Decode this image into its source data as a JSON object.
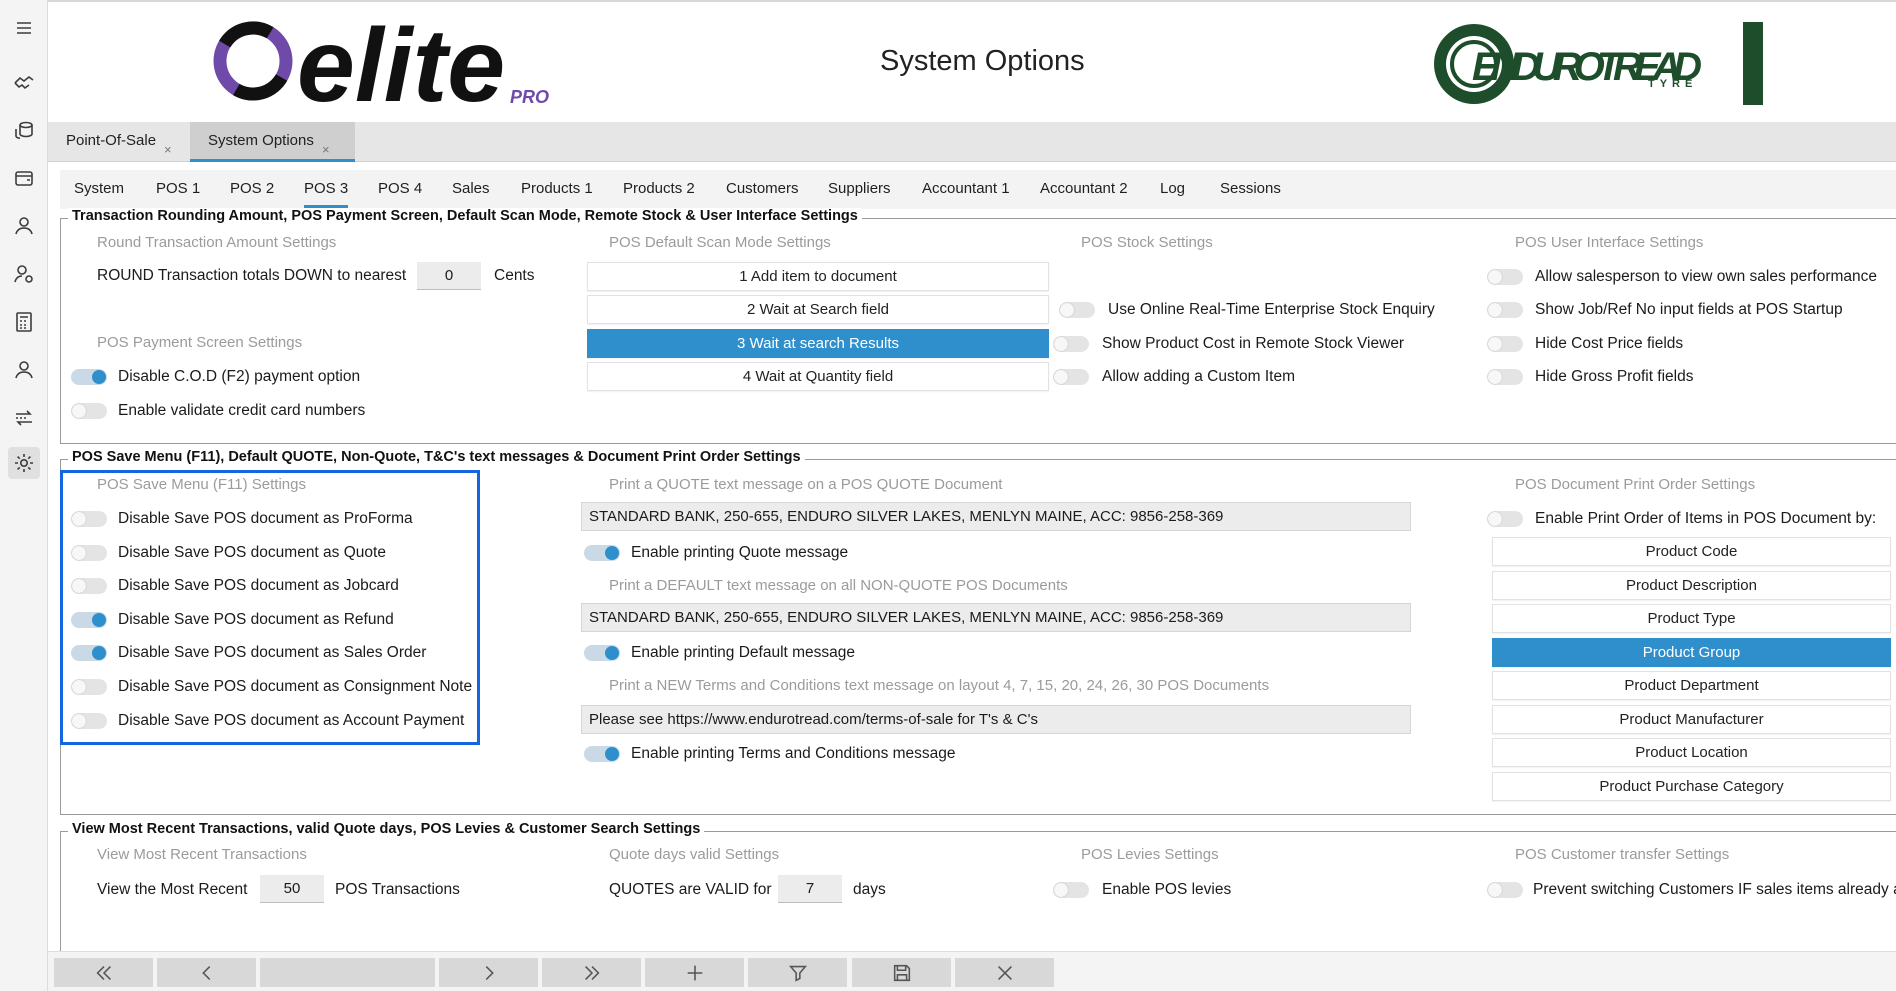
{
  "window": {
    "title": "System Options"
  },
  "brand": {
    "logo_text": "elite",
    "logo_sub": "PRO",
    "partner_logo": "ENDUROTREAD",
    "partner_sub": "TYRE",
    "partner_color": "#1d4d2a",
    "logo_accent": "#6f4aa8"
  },
  "rail": [
    "menu-icon",
    "handshake-icon",
    "coins-icon",
    "wallet-icon",
    "user-icon",
    "user-settings-icon",
    "calculator-icon",
    "user-icon",
    "transfer-icon",
    "gear-icon"
  ],
  "app_tabs": [
    {
      "label": "Point-Of-Sale",
      "close": "×"
    },
    {
      "label": "System Options",
      "close": "×"
    }
  ],
  "tabs": [
    "System",
    "POS 1",
    "POS 2",
    "POS 3",
    "POS 4",
    "Sales",
    "Products 1",
    "Products 2",
    "Customers",
    "Suppliers",
    "Accountant 1",
    "Accountant 2",
    "Log",
    "Sessions"
  ],
  "selected_tab": "POS 3",
  "section1": {
    "title": "Transaction Rounding Amount, POS Payment Screen, Default Scan Mode, Remote Stock & User Interface Settings",
    "rounding": {
      "heading": "Round Transaction Amount Settings",
      "label": "ROUND Transaction totals DOWN to nearest",
      "value": "0",
      "unit": "Cents"
    },
    "payment": {
      "heading": "POS Payment Screen Settings",
      "items": [
        {
          "label": "Disable C.O.D (F2) payment option",
          "on": true
        },
        {
          "label": "Enable validate credit card numbers",
          "on": false
        }
      ]
    },
    "scan": {
      "heading": "POS Default Scan Mode Settings",
      "options": [
        "1 Add item to document",
        "2 Wait at Search field",
        "3 Wait at search Results",
        "4 Wait at Quantity field"
      ],
      "selected": 2
    },
    "stock": {
      "heading": "POS Stock Settings",
      "items": [
        {
          "label": "Use Online Real-Time Enterprise Stock Enquiry",
          "on": false
        },
        {
          "label": "Show Product Cost in Remote Stock Viewer",
          "on": false
        },
        {
          "label": "Allow adding a Custom Item",
          "on": false
        }
      ]
    },
    "ui": {
      "heading": "POS User Interface Settings",
      "items": [
        {
          "label": "Allow salesperson to view own sales performance",
          "on": false
        },
        {
          "label": "Show Job/Ref No input fields at POS Startup",
          "on": false
        },
        {
          "label": "Hide Cost Price fields",
          "on": false
        },
        {
          "label": "Hide Gross Profit fields",
          "on": false
        }
      ]
    }
  },
  "section2": {
    "title": "POS Save Menu (F11), Default QUOTE, Non-Quote, T&C's text messages & Document Print Order Settings",
    "save_menu": {
      "heading": "POS Save Menu (F11) Settings",
      "items": [
        {
          "label": "Disable Save POS document as ProForma",
          "on": false
        },
        {
          "label": "Disable Save POS document as Quote",
          "on": false
        },
        {
          "label": "Disable Save POS document as Jobcard",
          "on": false
        },
        {
          "label": "Disable Save POS document as Refund",
          "on": true
        },
        {
          "label": "Disable Save POS document as Sales Order",
          "on": true
        },
        {
          "label": "Disable Save POS document as Consignment Note",
          "on": false
        },
        {
          "label": "Disable Save POS document as Account Payment",
          "on": false
        }
      ]
    },
    "quote_msg": {
      "heading": "Print a QUOTE text message on a POS QUOTE Document",
      "value": "STANDARD BANK, 250-655, ENDURO SILVER LAKES, MENLYN MAINE, ACC: 9856-258-369",
      "toggle_label": "Enable printing Quote message",
      "on": true
    },
    "default_msg": {
      "heading": "Print a DEFAULT text message on all NON-QUOTE POS Documents",
      "value": "STANDARD BANK, 250-655, ENDURO SILVER LAKES, MENLYN MAINE, ACC: 9856-258-369",
      "toggle_label": "Enable printing Default message",
      "on": true
    },
    "tc_msg": {
      "heading": "Print a NEW Terms and Conditions text message on layout 4, 7, 15, 20, 24, 26, 30 POS Documents",
      "value": "Please see https://www.endurotread.com/terms-of-sale for T's & C's",
      "toggle_label": "Enable printing Terms and Conditions message",
      "on": true
    },
    "print_order": {
      "heading": "POS Document Print Order Settings",
      "toggle_label": "Enable Print Order of Items in POS Document by:",
      "on": false,
      "options": [
        "Product Code",
        "Product Description",
        "Product Type",
        "Product Group",
        "Product Department",
        "Product Manufacturer",
        "Product Location",
        "Product Purchase Category"
      ],
      "selected": 3
    }
  },
  "section3": {
    "title": "View Most Recent Transactions, valid Quote days, POS Levies & Customer Search Settings",
    "recent": {
      "heading": "View Most Recent Transactions",
      "label": "View the Most Recent",
      "value": "50",
      "unit": "POS Transactions"
    },
    "quote_days": {
      "heading": "Quote days valid Settings",
      "label": "QUOTES are VALID for",
      "value": "7",
      "unit": "days"
    },
    "levies": {
      "heading": "POS Levies Settings",
      "label": "Enable POS levies",
      "on": false
    },
    "customer": {
      "heading": "POS Customer transfer Settings",
      "label": "Prevent switching Customers IF sales items already a",
      "on": false
    }
  },
  "bottom_nav": [
    "first-icon",
    "prev-icon",
    "",
    "next-icon",
    "last-icon",
    "add-icon",
    "filter-icon",
    "save-icon",
    "close-icon"
  ],
  "accent": "#2e8fcc",
  "highlight_color": "#1565e0"
}
